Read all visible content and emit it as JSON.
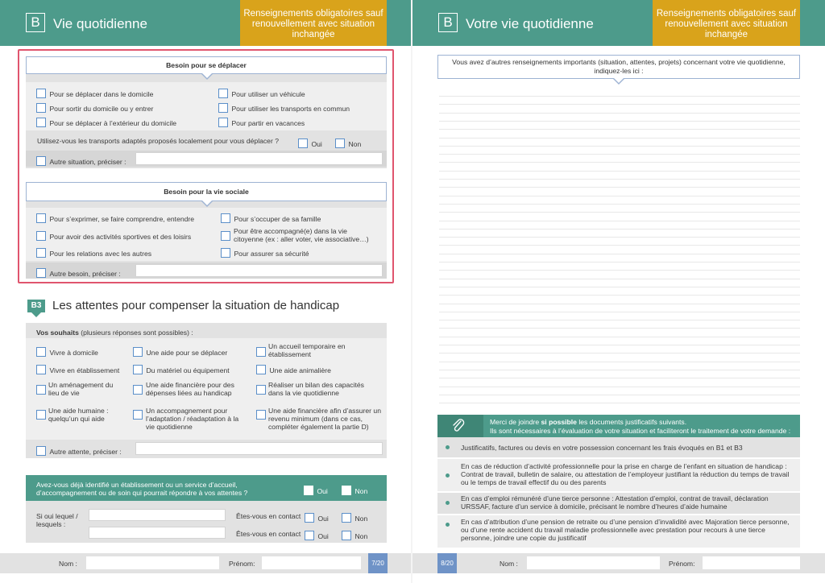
{
  "left": {
    "header": {
      "letter": "B",
      "title": "Vie quotidienne",
      "notice": "Renseignements obligatoires sauf renouvellement avec situation inchangée"
    },
    "deplacer": {
      "title": "Besoin pour se déplacer",
      "items": [
        "Pour se déplacer dans le domicile",
        "Pour utiliser un véhicule",
        "Pour sortir du domicile ou y entrer",
        "Pour utiliser les transports en commun",
        "Pour se déplacer à l’extérieur du domicile",
        "Pour partir en vacances"
      ],
      "question": "Utilisez-vous les transports adaptés proposés localement pour vous déplacer ?",
      "oui": "Oui",
      "non": "Non",
      "autre": "Autre situation, préciser :"
    },
    "sociale": {
      "title": "Besoin pour la vie sociale",
      "items": [
        "Pour s’exprimer, se faire comprendre, entendre",
        "Pour s’occuper de sa famille",
        "Pour avoir des activités sportives et des loisirs",
        "Pour être accompagné(e) dans la vie citoyenne (ex : aller voter, vie associative…)",
        "Pour les relations avec les autres",
        "Pour assurer sa sécurité"
      ],
      "autre": "Autre besoin, préciser :"
    },
    "b3": {
      "badge": "B3",
      "title": "Les attentes pour compenser la situation de handicap",
      "souhaits_bold": "Vos souhaits",
      "souhaits_rest": " (plusieurs réponses sont possibles) :",
      "items": [
        "Vivre à domicile",
        "Une aide pour se déplacer",
        "Un accueil temporaire en établissement",
        "Vivre en établissement",
        "Du matériel ou équipement",
        "Une aide animalière",
        "Un aménagement du lieu de vie",
        "Une aide financière pour des dépenses liées au handicap",
        "Réaliser un bilan des capacités dans la vie quotidienne",
        "Une aide humaine : quelqu’un qui aide",
        "Un accompagnement pour l’adaptation / réadaptation à la vie quotidienne",
        "Une aide financière afin d’assurer un revenu minimum (dans ce cas, compléter également la partie D)"
      ],
      "autre": "Autre attente, préciser :"
    },
    "etab": {
      "question": "Avez-vous déjà identifié un établissement ou un service d’accueil, d’accompagnement ou de soin qui pourrait répondre à vos attentes ?",
      "oui": "Oui",
      "non": "Non",
      "lequel": "Si oui lequel / lesquels :",
      "contact": "Êtes-vous en contact",
      "contact_oui": "Oui",
      "contact_non": "Non"
    },
    "footer": {
      "nom": "Nom :",
      "prenom": "Prénom:",
      "page": "7/20"
    }
  },
  "right": {
    "header": {
      "letter": "B",
      "title": "Votre vie quotidienne",
      "notice": "Renseignements obligatoires sauf renouvellement avec situation inchangée"
    },
    "intro": "Vous avez d’autres renseignements importants (situation, attentes, projets) concernant votre vie quotidienne, indiquez-les ici :",
    "docs": {
      "line1_a": "Merci de joindre ",
      "line1_b": "si possible",
      "line1_c": " les documents justificatifs suivants.",
      "line2": "Ils sont nécessaires à l’évaluation de votre situation et faciliteront le traitement de votre demande :",
      "items": [
        "Justificatifs, factures ou devis en votre possession concernant les frais évoqués en B1 et B3",
        "En cas de réduction d’activité professionnelle pour la prise en charge de l’enfant en situation de handicap : Contrat de travail, bulletin de salaire, ou attestation de l’employeur justifiant la réduction du temps de travail ou le temps de travail effectif du ou des parents",
        "En cas d’emploi rémunéré d’une tierce personne : Attestation d’emploi, contrat de travail, déclaration URSSAF, facture d’un service à domicile, précisant le nombre d’heures d’aide humaine",
        "En cas d’attribution d’une pension de retraite ou d’une pension d’invalidité avec Majoration tierce personne, ou d’une rente accident du travail maladie professionnelle avec prestation pour recours à une tierce personne, joindre une copie du justificatif"
      ]
    },
    "footer": {
      "page": "8/20",
      "nom": "Nom :",
      "prenom": "Prénom:"
    }
  },
  "colors": {
    "teal": "#4d9b8b",
    "yellow": "#d9a31b",
    "highlight": "#e0556e",
    "checkbox": "#5b8fc9"
  }
}
